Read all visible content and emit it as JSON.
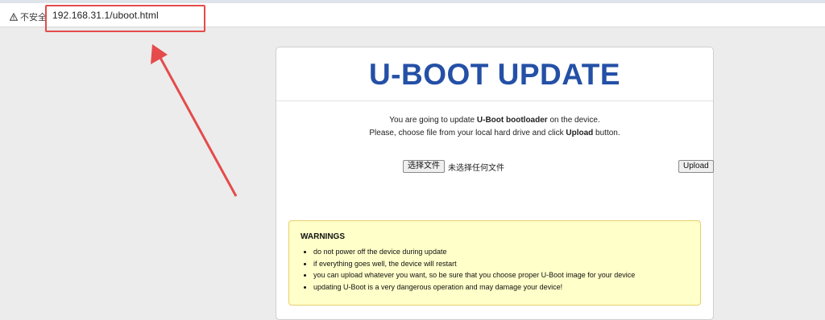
{
  "browser": {
    "security_label": "不安全",
    "url": "192.168.31.1/uboot.html"
  },
  "page": {
    "title": "U-BOOT UPDATE",
    "intro_line1_pre": "You are going to update ",
    "intro_line1_bold": "U-Boot bootloader",
    "intro_line1_post": " on the device.",
    "intro_line2_pre": "Please, choose file from your local hard drive and click ",
    "intro_line2_bold": "Upload",
    "intro_line2_post": " button."
  },
  "upload": {
    "choose_file_label": "选择文件",
    "file_status": "未选择任何文件",
    "upload_label": "Upload"
  },
  "warnings": {
    "title": "WARNINGS",
    "items": [
      "do not power off the device during update",
      "if everything goes well, the device will restart",
      "you can upload whatever you want, so be sure that you choose proper U-Boot image for your device",
      "updating U-Boot is a very dangerous operation and may damage your device!"
    ]
  },
  "colors": {
    "title": "#2450a6",
    "annotation": "#e54b4b",
    "warning_bg": "#ffffc9"
  }
}
